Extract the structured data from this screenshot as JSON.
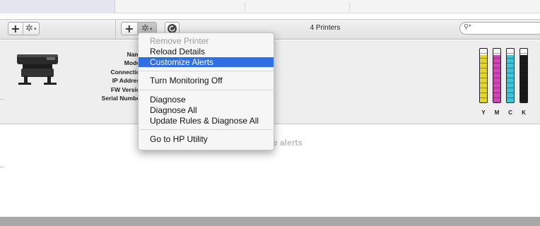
{
  "toolbar": {
    "left_add_icon": "plus-icon",
    "left_action_icon": "gear-icon",
    "right_add_icon": "plus-icon",
    "right_action_icon": "gear-icon",
    "refresh_icon": "refresh-icon",
    "printer_count": "4 Printers",
    "search_icon": "search-icon"
  },
  "details": {
    "labels": [
      "Nam",
      "Mode",
      "Connectio",
      "IP Addres",
      "FW Versio",
      "Serial Numbe"
    ]
  },
  "ink": {
    "cartridges": [
      {
        "label": "Y",
        "color": "#e3d52b",
        "level": 0.88
      },
      {
        "label": "M",
        "color": "#cf46b4",
        "level": 0.88
      },
      {
        "label": "C",
        "color": "#3cc3d8",
        "level": 0.88
      },
      {
        "label": "K",
        "color": "#1a1a1a",
        "level": 0.88
      }
    ]
  },
  "content": {
    "alerts_fragment": "e alerts"
  },
  "menu": {
    "items": [
      {
        "label": "Remove Printer",
        "state": "disabled"
      },
      {
        "label": "Reload Details",
        "state": "enabled"
      },
      {
        "label": "Customize Alerts",
        "state": "selected"
      },
      {
        "label": "Turn Monitoring Off",
        "state": "enabled"
      },
      {
        "label": "Diagnose",
        "state": "enabled"
      },
      {
        "label": "Diagnose All",
        "state": "enabled"
      },
      {
        "label": "Update Rules & Diagnose All",
        "state": "enabled"
      },
      {
        "label": "Go to HP Utility",
        "state": "enabled"
      }
    ]
  }
}
